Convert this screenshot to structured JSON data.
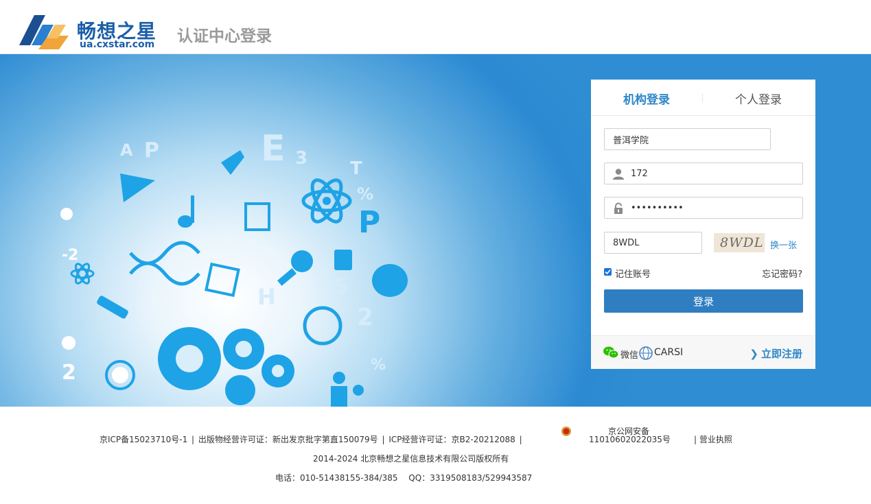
{
  "header": {
    "brand_cn": "畅想之星",
    "brand_url": "ua.cxstar.com",
    "title": "认证中心登录"
  },
  "login": {
    "tabs": [
      {
        "label": "机构登录",
        "active": true
      },
      {
        "label": "个人登录",
        "active": false
      }
    ],
    "school": {
      "value": "普洱学院"
    },
    "username": {
      "value": "172",
      "icon": "user-icon"
    },
    "password": {
      "value": "••••••••••",
      "icon": "lock-icon"
    },
    "captcha": {
      "value": "8WDL",
      "image_text": "8WDL",
      "refresh_label": "换一张"
    },
    "remember": {
      "label": "记住账号",
      "checked": true
    },
    "forgot_label": "忘记密码?",
    "submit_label": "登录",
    "wechat_label": "微信",
    "carsi_label": "CARSI",
    "register_label": "立即注册"
  },
  "footer": {
    "icp": "京ICP备15023710号-1",
    "publish": "出版物经营许可证：新出发京批字第直150079号",
    "icp_license": "ICP经营许可证：京B2-20212088",
    "police_top": "京公网安备",
    "police_bot": "11010602022035号",
    "business_license": "营业执照",
    "copyright": "2014-2024 北京畅想之星信息技术有限公司版权所有",
    "contact": "电话：010-51438155-384/385　  QQ：3319508183/529943587"
  },
  "colors": {
    "brand_blue": "#1b5ea8",
    "accent": "#2e86c9",
    "button": "#2f7ec1",
    "banner_edge": "#2f8ed3"
  }
}
